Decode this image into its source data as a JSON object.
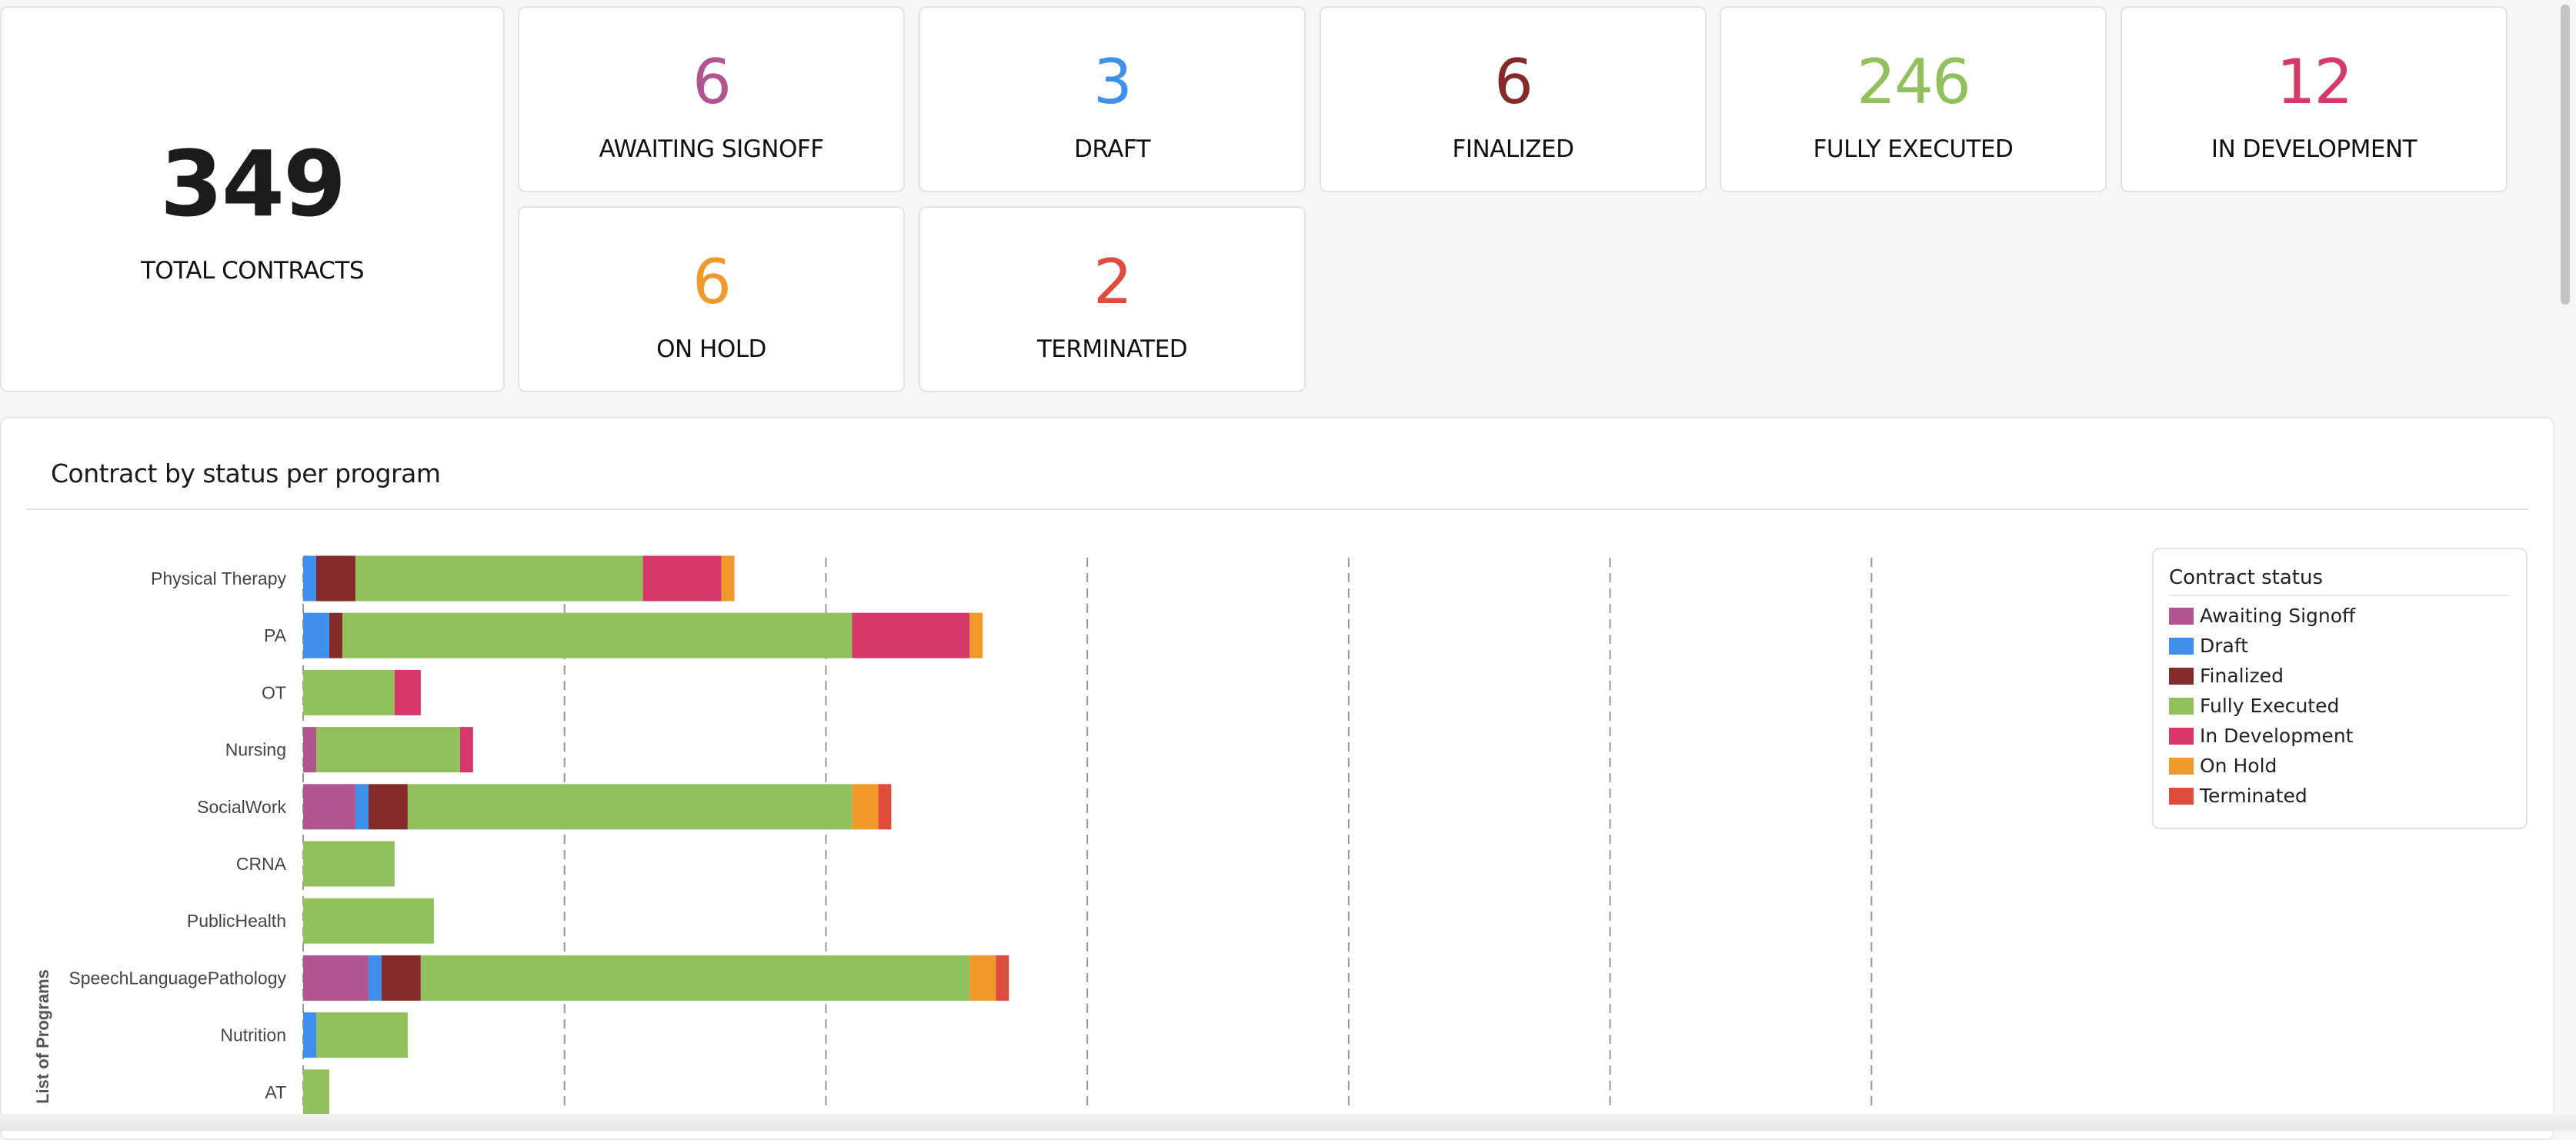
{
  "summary": {
    "total": {
      "value": "349",
      "label": "TOTAL CONTRACTS"
    },
    "cards": [
      {
        "value": "6",
        "label": "AWAITING SIGNOFF",
        "color": "#b0558f"
      },
      {
        "value": "3",
        "label": "DRAFT",
        "color": "#3f8fec"
      },
      {
        "value": "6",
        "label": "FINALIZED",
        "color": "#852a2a"
      },
      {
        "value": "246",
        "label": "FULLY EXECUTED",
        "color": "#92c05c"
      },
      {
        "value": "12",
        "label": "IN DEVELOPMENT",
        "color": "#d6386a"
      },
      {
        "value": "6",
        "label": "ON HOLD",
        "color": "#f09a2c"
      },
      {
        "value": "2",
        "label": "TERMINATED",
        "color": "#e14b3b"
      }
    ]
  },
  "chart_panel": {
    "title": "Contract by status per program"
  },
  "chart_data": {
    "type": "bar",
    "orientation": "horizontal",
    "stacked": true,
    "ylabel": "List of Programs",
    "categories": [
      "Physical Therapy",
      "PA",
      "OT",
      "Nursing",
      "SocialWork",
      "CRNA",
      "PublicHealth",
      "SpeechLanguagePathology",
      "Nutrition",
      "AT"
    ],
    "series": [
      {
        "name": "Awaiting Signoff",
        "color": "#b0558f",
        "values": [
          0,
          0,
          0,
          1,
          4,
          0,
          0,
          5,
          0,
          0
        ]
      },
      {
        "name": "Draft",
        "color": "#3f8fec",
        "values": [
          1,
          2,
          0,
          0,
          1,
          0,
          0,
          1,
          1,
          0
        ]
      },
      {
        "name": "Finalized",
        "color": "#852a2a",
        "values": [
          3,
          1,
          0,
          0,
          3,
          0,
          0,
          3,
          0,
          0
        ]
      },
      {
        "name": "Fully Executed",
        "color": "#92c05c",
        "values": [
          22,
          39,
          7,
          11,
          34,
          7,
          10,
          42,
          7,
          2
        ]
      },
      {
        "name": "In Development",
        "color": "#d6386a",
        "values": [
          6,
          9,
          2,
          1,
          0,
          0,
          0,
          0,
          0,
          0
        ]
      },
      {
        "name": "On Hold",
        "color": "#f09a2c",
        "values": [
          1,
          1,
          0,
          0,
          2,
          0,
          0,
          2,
          0,
          0
        ]
      },
      {
        "name": "Terminated",
        "color": "#e14b3b",
        "values": [
          0,
          0,
          0,
          0,
          1,
          0,
          0,
          1,
          0,
          0
        ]
      }
    ],
    "xlim": [
      0,
      140
    ],
    "grid": "vertical-dashed",
    "legend": {
      "title": "Contract status",
      "position": "right"
    }
  }
}
